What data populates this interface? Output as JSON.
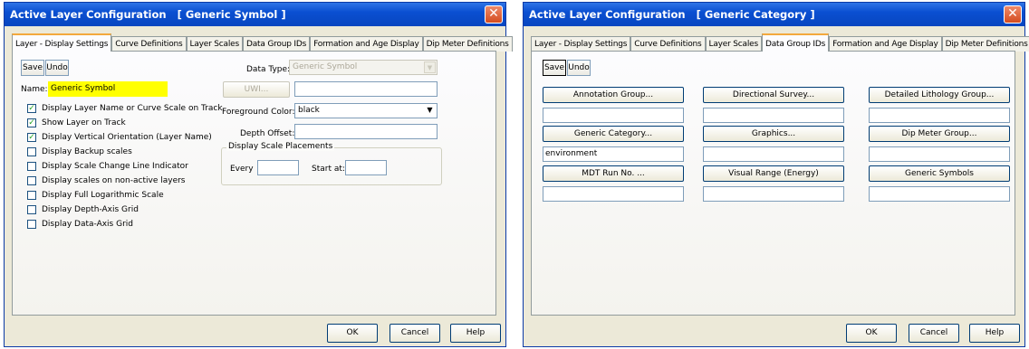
{
  "dialog1": {
    "title": "Active Layer Configuration   [ Generic Symbol ]",
    "close_glyph": "✕",
    "tabs": [
      "Layer - Display Settings",
      "Curve Definitions",
      "Layer Scales",
      "Data Group IDs",
      "Formation and Age Display",
      "Dip Meter Definitions"
    ],
    "save_label": "Save",
    "undo_label": "Undo",
    "name_label": "Name:",
    "name_value": "Generic Symbol",
    "checkboxes": [
      {
        "label": "Display Layer Name or Curve Scale on Track",
        "checked": true
      },
      {
        "label": "Show Layer on Track",
        "checked": true
      },
      {
        "label": "Display Vertical Orientation (Layer Name)",
        "checked": true
      },
      {
        "label": "Display Backup scales",
        "checked": false
      },
      {
        "label": "Display Scale Change Line Indicator",
        "checked": false
      },
      {
        "label": "Display scales on non-active layers",
        "checked": false
      },
      {
        "label": "Display Full Logarithmic Scale",
        "checked": false
      },
      {
        "label": "Display Depth-Axis Grid",
        "checked": false
      },
      {
        "label": "Display Data-Axis Grid",
        "checked": false
      }
    ],
    "check_glyph": "✓",
    "data_type_label": "Data Type:",
    "data_type_value": "Generic Symbol",
    "uwi_label": "UWI...",
    "uwi_value": "",
    "foreground_label": "Foreground Color:",
    "foreground_value": "black",
    "depth_offset_label": "Depth Offset:",
    "depth_offset_value": "",
    "placements_label": "Display Scale Placements",
    "every_label": "Every",
    "every_value": "",
    "start_label": "Start at:",
    "start_value": "",
    "dropdown_glyph": "▼",
    "ok_label": "OK",
    "cancel_label": "Cancel",
    "help_label": "Help"
  },
  "dialog2": {
    "title": "Active Layer Configuration   [ Generic Category ]",
    "close_glyph": "✕",
    "tabs": [
      "Layer - Display Settings",
      "Curve Definitions",
      "Layer Scales",
      "Data Group IDs",
      "Formation and Age Display",
      "Dip Meter Definitions"
    ],
    "save_label": "Save",
    "undo_label": "Undo",
    "groups": [
      {
        "label": "Annotation Group...",
        "value": ""
      },
      {
        "label": "Directional Survey...",
        "value": ""
      },
      {
        "label": "Detailed Lithology Group...",
        "value": ""
      },
      {
        "label": "Generic Category...",
        "value": "environment"
      },
      {
        "label": "Graphics...",
        "value": ""
      },
      {
        "label": "Dip Meter Group...",
        "value": ""
      },
      {
        "label": "MDT Run No. ...",
        "value": ""
      },
      {
        "label": "Visual Range (Energy)",
        "value": ""
      },
      {
        "label": "Generic Symbols",
        "value": ""
      }
    ],
    "ok_label": "OK",
    "cancel_label": "Cancel",
    "help_label": "Help"
  }
}
